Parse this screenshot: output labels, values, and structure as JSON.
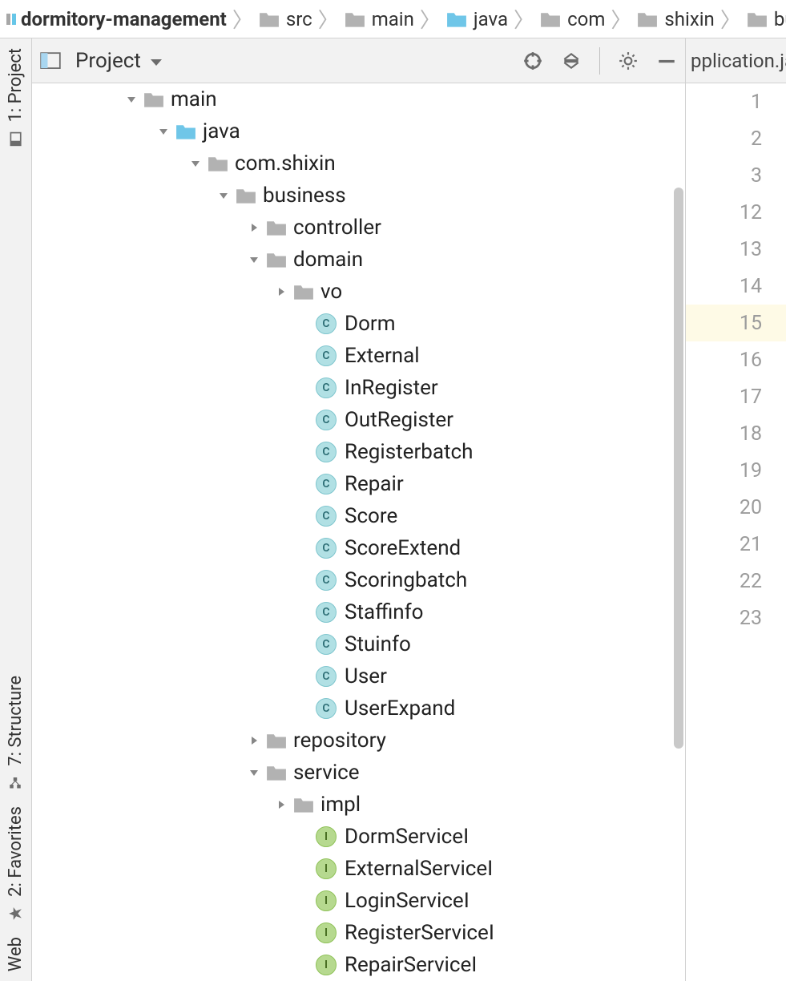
{
  "breadcrumb": [
    {
      "label": "dormitory-management",
      "type": "module",
      "bold": true
    },
    {
      "label": "src",
      "type": "folder"
    },
    {
      "label": "main",
      "type": "folder"
    },
    {
      "label": "java",
      "type": "folder-open"
    },
    {
      "label": "com",
      "type": "folder"
    },
    {
      "label": "shixin",
      "type": "folder"
    },
    {
      "label": "bu",
      "type": "folder"
    }
  ],
  "sidebar": {
    "top": [
      {
        "label": "1: Project"
      }
    ],
    "bottom": [
      {
        "label": "7: Structure"
      },
      {
        "label": "2: Favorites"
      },
      {
        "label": "Web"
      }
    ]
  },
  "projectHeader": {
    "title": "Project"
  },
  "tree": [
    {
      "indent": 115,
      "arrow": "down",
      "icon": "folder",
      "label": "main"
    },
    {
      "indent": 155,
      "arrow": "down",
      "icon": "folder-open",
      "label": "java"
    },
    {
      "indent": 195,
      "arrow": "down",
      "icon": "folder",
      "label": "com.shixin"
    },
    {
      "indent": 230,
      "arrow": "down",
      "icon": "folder",
      "label": "business"
    },
    {
      "indent": 268,
      "arrow": "right",
      "icon": "folder",
      "label": "controller"
    },
    {
      "indent": 268,
      "arrow": "down",
      "icon": "folder",
      "label": "domain"
    },
    {
      "indent": 302,
      "arrow": "right",
      "icon": "folder",
      "label": "vo"
    },
    {
      "indent": 330,
      "arrow": "",
      "icon": "class",
      "label": "Dorm"
    },
    {
      "indent": 330,
      "arrow": "",
      "icon": "class",
      "label": "External"
    },
    {
      "indent": 330,
      "arrow": "",
      "icon": "class",
      "label": "InRegister"
    },
    {
      "indent": 330,
      "arrow": "",
      "icon": "class",
      "label": "OutRegister"
    },
    {
      "indent": 330,
      "arrow": "",
      "icon": "class",
      "label": "Registerbatch"
    },
    {
      "indent": 330,
      "arrow": "",
      "icon": "class",
      "label": "Repair"
    },
    {
      "indent": 330,
      "arrow": "",
      "icon": "class",
      "label": "Score"
    },
    {
      "indent": 330,
      "arrow": "",
      "icon": "class",
      "label": "ScoreExtend"
    },
    {
      "indent": 330,
      "arrow": "",
      "icon": "class",
      "label": "Scoringbatch"
    },
    {
      "indent": 330,
      "arrow": "",
      "icon": "class",
      "label": "Staffinfo"
    },
    {
      "indent": 330,
      "arrow": "",
      "icon": "class",
      "label": "Stuinfo"
    },
    {
      "indent": 330,
      "arrow": "",
      "icon": "class",
      "label": "User"
    },
    {
      "indent": 330,
      "arrow": "",
      "icon": "class",
      "label": "UserExpand"
    },
    {
      "indent": 268,
      "arrow": "right",
      "icon": "folder",
      "label": "repository"
    },
    {
      "indent": 268,
      "arrow": "down",
      "icon": "folder",
      "label": "service"
    },
    {
      "indent": 302,
      "arrow": "right",
      "icon": "folder",
      "label": "impl"
    },
    {
      "indent": 330,
      "arrow": "",
      "icon": "interface",
      "label": "DormServiceI"
    },
    {
      "indent": 330,
      "arrow": "",
      "icon": "interface",
      "label": "ExternalServiceI"
    },
    {
      "indent": 330,
      "arrow": "",
      "icon": "interface",
      "label": "LoginServiceI"
    },
    {
      "indent": 330,
      "arrow": "",
      "icon": "interface",
      "label": "RegisterServiceI"
    },
    {
      "indent": 330,
      "arrow": "",
      "icon": "interface",
      "label": "RepairServiceI"
    }
  ],
  "editor": {
    "tabLabel": "pplication.ja",
    "lines": [
      1,
      2,
      3,
      12,
      13,
      14,
      15,
      16,
      17,
      18,
      19,
      20,
      21,
      22,
      23
    ],
    "highlightLine": 15
  }
}
